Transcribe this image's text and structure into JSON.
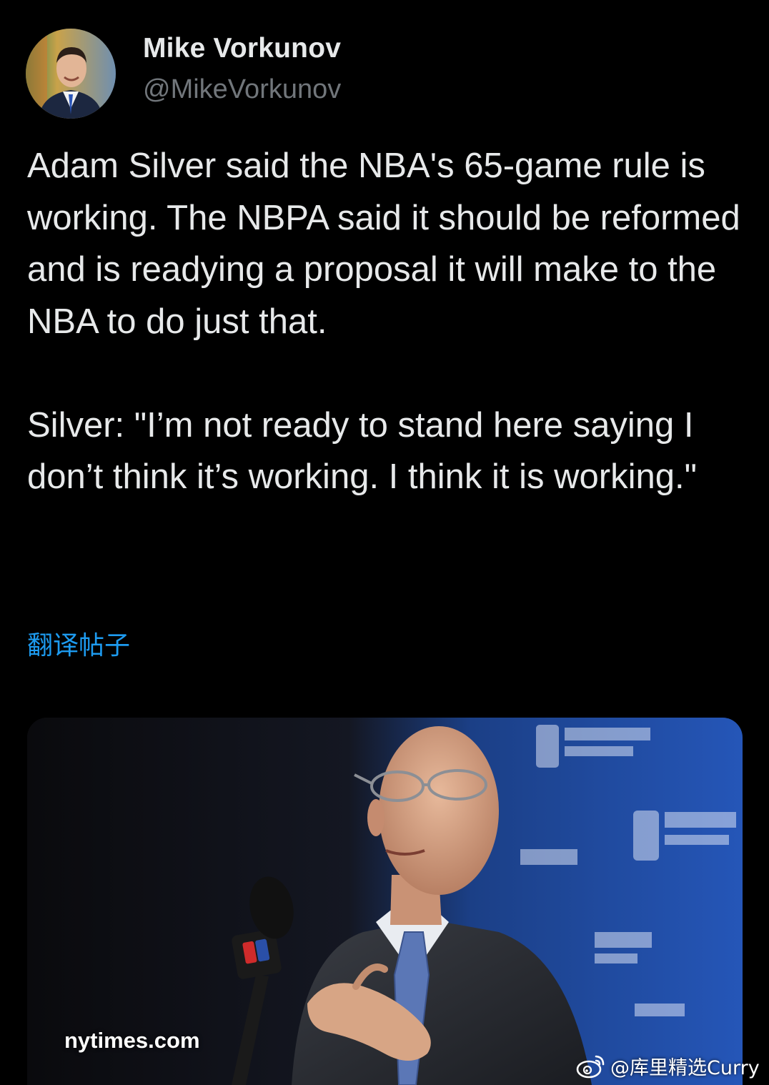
{
  "author": {
    "display_name": "Mike Vorkunov",
    "handle": "@MikeVorkunov"
  },
  "tweet": {
    "paragraphs": [
      "Adam Silver said the NBA's 65-game rule is working. The NBPA said it should be reformed and is readying a proposal it will make to the NBA to do just that.",
      "Silver: \"I’m not ready to stand here saying I don’t think it’s working. I think it is working.\""
    ],
    "translate_label": "翻译帖子"
  },
  "media": {
    "source": "nytimes.com"
  },
  "watermark": {
    "text": "@库里精选Curry"
  },
  "colors": {
    "background": "#000000",
    "text": "#e7e9ea",
    "secondary_text": "#71767b",
    "link": "#1d9bf0"
  }
}
